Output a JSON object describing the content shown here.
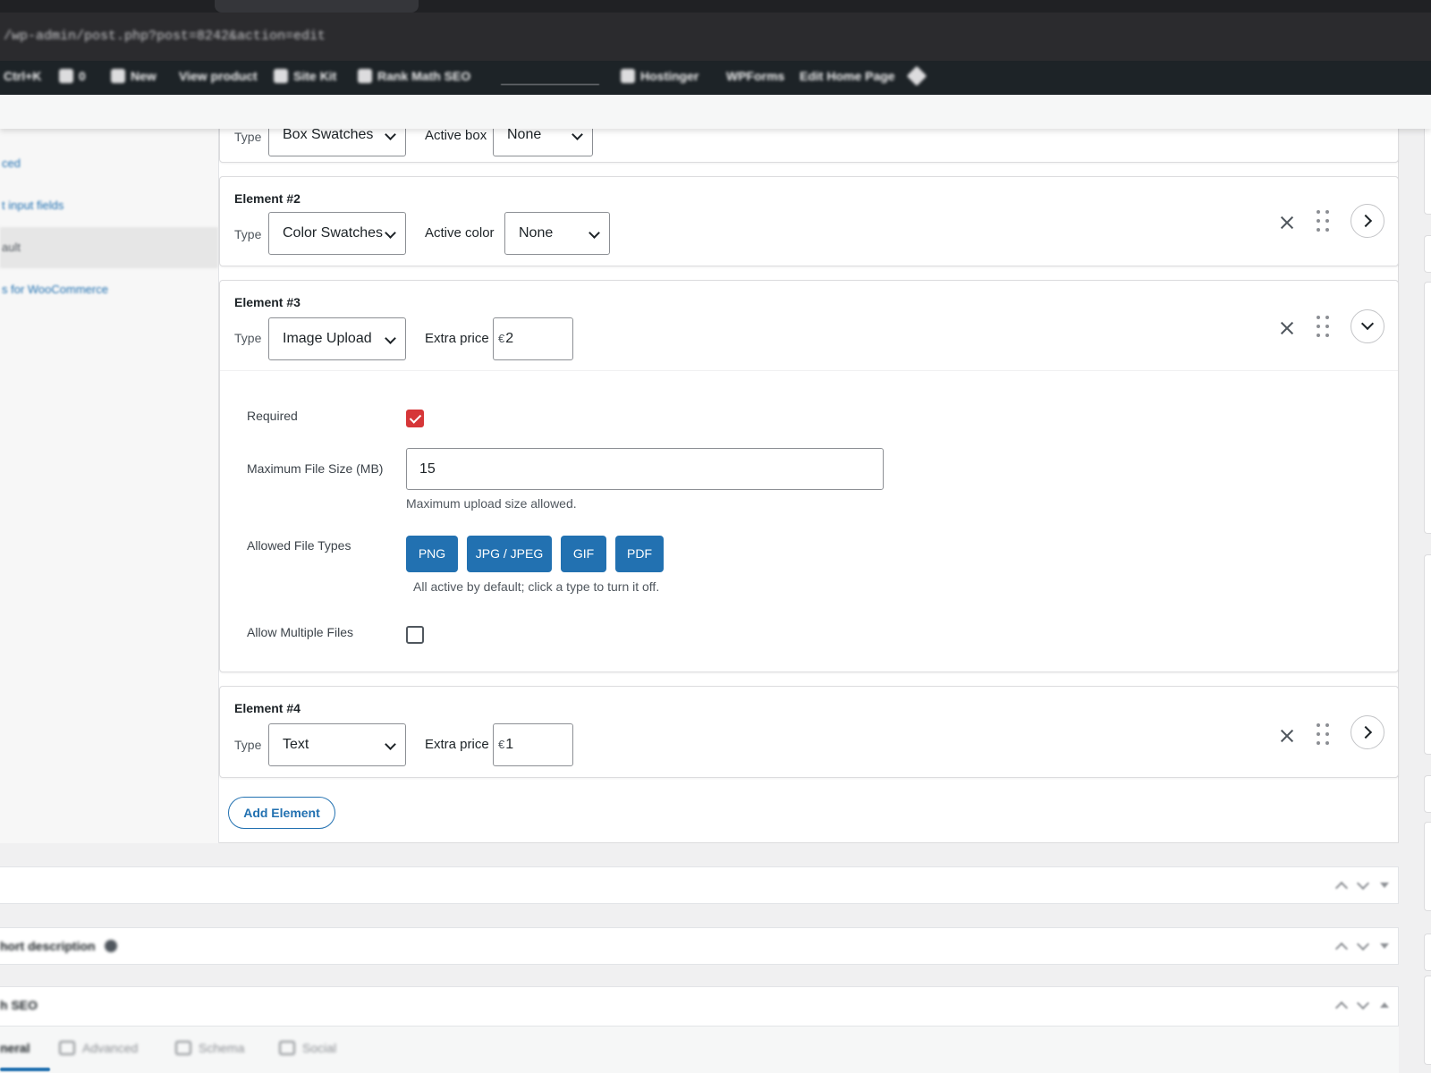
{
  "browser": {
    "url": "/wp-admin/post.php?post=8242&action=edit"
  },
  "admin_bar": {
    "items": [
      {
        "label": "Ctrl+K",
        "icon": "command-icon"
      },
      {
        "label": "0",
        "icon": "comment-icon"
      },
      {
        "label": "New",
        "icon": "plus-icon"
      },
      {
        "label": "View product",
        "icon": ""
      },
      {
        "label": "Site Kit",
        "icon": "google-icon"
      },
      {
        "label": "Rank Math SEO",
        "icon": "rank-math-icon"
      },
      {
        "label": "Hostinger",
        "icon": "hostinger-icon"
      },
      {
        "label": "WPForms",
        "icon": ""
      },
      {
        "label": "Edit Home Page",
        "icon": ""
      }
    ]
  },
  "left_menu": {
    "items": [
      {
        "label": "ced"
      },
      {
        "label": "t input fields"
      },
      {
        "label": "ault"
      },
      {
        "label": "s for WooCommerce"
      }
    ]
  },
  "elements": [
    {
      "title": "",
      "type_label": "Type",
      "type_value": "Box Swatches",
      "extra_label": "Active box",
      "extra_value": "None",
      "state": "collapsed"
    },
    {
      "title": "Element #2",
      "type_label": "Type",
      "type_value": "Color Swatches",
      "extra_label": "Active color",
      "extra_value": "None",
      "state": "collapsed"
    },
    {
      "title": "Element #3",
      "type_label": "Type",
      "type_value": "Image Upload",
      "extra_label": "Extra price",
      "currency": "€",
      "extra_value": "2",
      "state": "expanded",
      "options": {
        "required_label": "Required",
        "required_checked": true,
        "max_size_label": "Maximum File Size (MB)",
        "max_size_value": "15",
        "max_size_help": "Maximum upload size allowed.",
        "file_types_label": "Allowed File Types",
        "file_types": [
          "PNG",
          "JPG / JPEG",
          "GIF",
          "PDF"
        ],
        "file_types_help": "All active by default; click a type to turn it off.",
        "multiple_label": "Allow Multiple Files",
        "multiple_checked": false
      }
    },
    {
      "title": "Element #4",
      "type_label": "Type",
      "type_value": "Text",
      "extra_label": "Extra price",
      "currency": "€",
      "extra_value": "1",
      "state": "collapsed"
    }
  ],
  "add_element_label": "Add Element",
  "postboxes": [
    {
      "title": ""
    },
    {
      "title": "hort description"
    },
    {
      "title": "h SEO"
    }
  ],
  "rank_math_tabs": [
    {
      "label": "neral",
      "icon": ""
    },
    {
      "label": "Advanced",
      "icon": "briefcase-icon"
    },
    {
      "label": "Schema",
      "icon": "cart-icon"
    },
    {
      "label": "Social",
      "icon": "share-icon"
    }
  ],
  "colors": {
    "primary": "#2271b1",
    "checked": "#d63638",
    "admin_bar": "#1d2327"
  }
}
